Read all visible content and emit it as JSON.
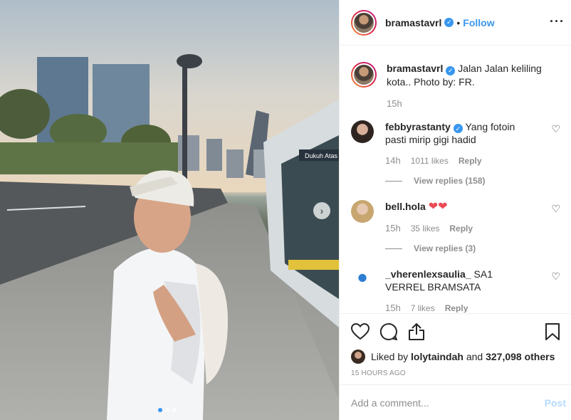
{
  "post": {
    "carousel": {
      "slide_count": 3,
      "active_index": 0,
      "station_sign": "Dukuh Atas"
    }
  },
  "header": {
    "username": "bramastavrl",
    "follow_label": "Follow",
    "bullet": "•",
    "more_icon": "ellipsis-icon"
  },
  "caption": {
    "username": "bramastavrl",
    "text": "Jalan Jalan keliling kota.. Photo by: FR.",
    "time": "15h"
  },
  "comments": [
    {
      "username": "febbyrastanty",
      "verified": true,
      "text": "Yang fotoin pasti mirip gigi hadid",
      "time": "14h",
      "likes": "1011 likes",
      "reply": "Reply",
      "view_replies": "View replies (158)"
    },
    {
      "username": "bell.hola",
      "verified": false,
      "text": "❤❤",
      "time": "15h",
      "likes": "35 likes",
      "reply": "Reply",
      "view_replies": "View replies (3)"
    },
    {
      "username": "_vherenlexsaulia_",
      "verified": false,
      "text": "SA1 VERREL BRAMSATA",
      "time": "15h",
      "likes": "7 likes",
      "reply": "Reply"
    }
  ],
  "likes": {
    "prefix": "Liked by",
    "user": "lolytaindah",
    "connector": "and",
    "others": "327,098 others"
  },
  "timestamp": "15 HOURS AGO",
  "add_comment": {
    "placeholder": "Add a comment...",
    "post_label": "Post"
  },
  "colors": {
    "accent": "#3897f0",
    "like_red": "#ed4956",
    "muted": "#8e8e8e"
  }
}
